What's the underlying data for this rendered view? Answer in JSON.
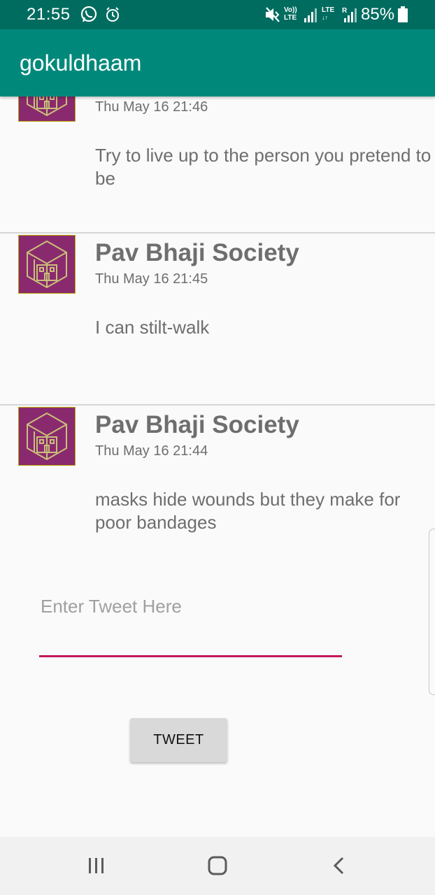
{
  "status_bar": {
    "time": "21:55",
    "battery": "85%",
    "icons": [
      "whatsapp-icon",
      "alarm-icon",
      "mute-vibrate-icon",
      "volte-icon",
      "signal-icon",
      "lte-icon",
      "signal-roaming-icon",
      "battery-icon"
    ],
    "volte_label_top": "Vo))",
    "volte_label_bottom": "LTE",
    "lte_label": "LTE",
    "roaming_label": "R"
  },
  "app_bar": {
    "title": "gokuldhaam"
  },
  "feed": {
    "posts": [
      {
        "author": "",
        "time": "Thu May 16 21:46",
        "body": "Try to live up to the person you pretend to be"
      },
      {
        "author": "Pav Bhaji Society",
        "time": "Thu May 16 21:45",
        "body": "I can stilt-walk"
      },
      {
        "author": "Pav Bhaji Society",
        "time": "Thu May 16 21:44",
        "body": "masks hide wounds but they make for poor bandages"
      }
    ]
  },
  "compose": {
    "placeholder": "Enter Tweet Here",
    "value": "",
    "button_label": "TWEET"
  },
  "colors": {
    "status_bar": "#006c5f",
    "app_bar": "#00897b",
    "accent_underline": "#c2185b",
    "avatar_bg": "#8a2a6e",
    "avatar_line": "#c9c07a"
  },
  "nav_bar": {
    "icons": [
      "recent-apps-icon",
      "home-icon",
      "back-icon"
    ]
  }
}
